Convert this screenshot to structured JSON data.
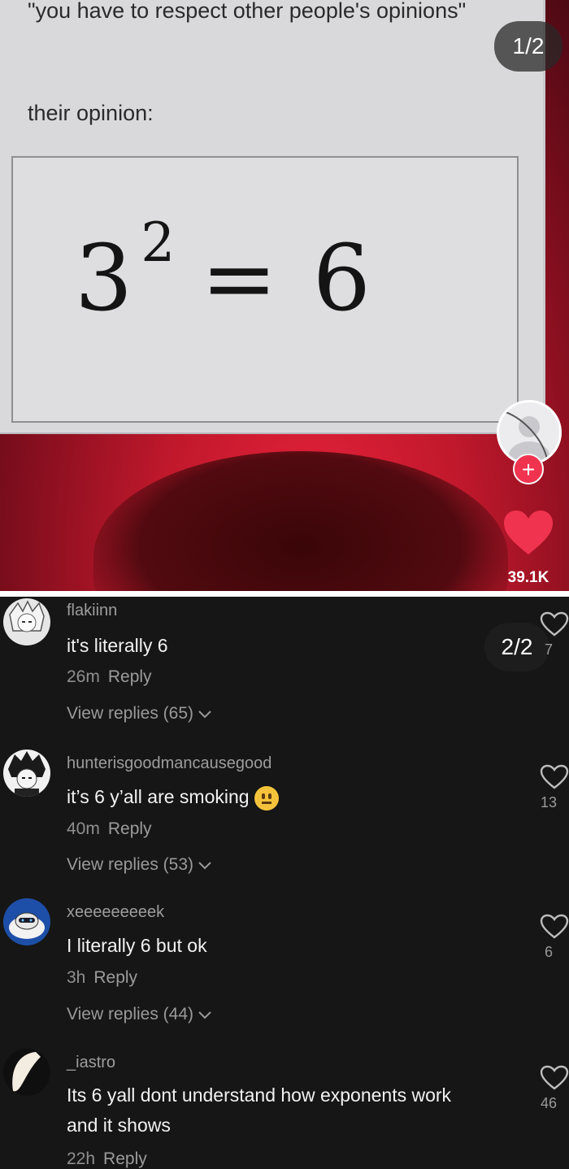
{
  "top_panel": {
    "quote": "\"you have to respect other people's opinions\"",
    "label": "their opinion:",
    "equation": {
      "base": "3",
      "exponent": "2",
      "rest": "= 6"
    },
    "page_indicator": "1/2",
    "likes": "39.1K",
    "follow_symbol": "+",
    "colors": {
      "heart": "#f0334e",
      "background_red": "#c0182c"
    }
  },
  "bottom_panel": {
    "page_indicator": "2/2",
    "comments": [
      {
        "user": "flakiinn",
        "text": "it's literally 6",
        "time": "26m",
        "reply": "Reply",
        "view_replies": "View replies (65)",
        "likes": "7"
      },
      {
        "user": "hunterisgoodmancausegood",
        "text": "it’s 6 y’all are smoking",
        "emoji": "neutral-face",
        "time": "40m",
        "reply": "Reply",
        "view_replies": "View replies (53)",
        "likes": "13"
      },
      {
        "user": "xeeeeeeeeek",
        "text": "I literally 6 but ok",
        "time": "3h",
        "reply": "Reply",
        "view_replies": "View replies (44)",
        "likes": "6"
      },
      {
        "user": "_iastro",
        "text": "Its 6 yall dont understand how exponents work and it shows",
        "time": "22h",
        "reply": "Reply",
        "likes": "46"
      }
    ]
  }
}
